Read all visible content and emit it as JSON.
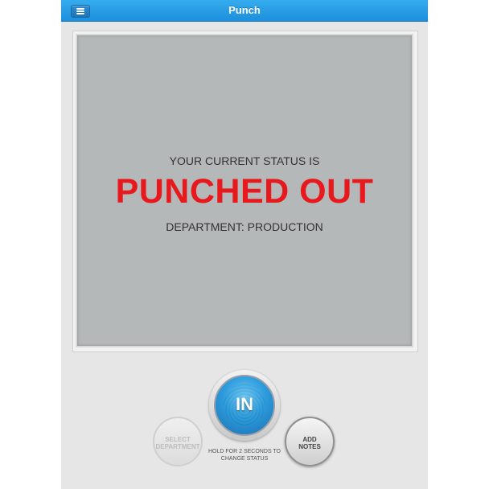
{
  "navbar": {
    "title": "Punch",
    "menu_icon": "hamburger-menu-icon",
    "bar_color": "#1c8fdc"
  },
  "status": {
    "intro": "YOUR CURRENT STATUS IS",
    "value": "PUNCHED OUT",
    "value_color": "#e8191c",
    "department_line": "DEPARTMENT: PRODUCTION"
  },
  "actions": {
    "in_button_label": "IN",
    "in_button_icon": "fingerprint-icon",
    "hold_caption_line1": "HOLD FOR 2 SECONDS TO",
    "hold_caption_line2": "CHANGE STATUS",
    "select_department_line1": "SELECT",
    "select_department_line2": "DEPARTMENT",
    "add_notes_line1": "ADD",
    "add_notes_line2": "NOTES"
  }
}
